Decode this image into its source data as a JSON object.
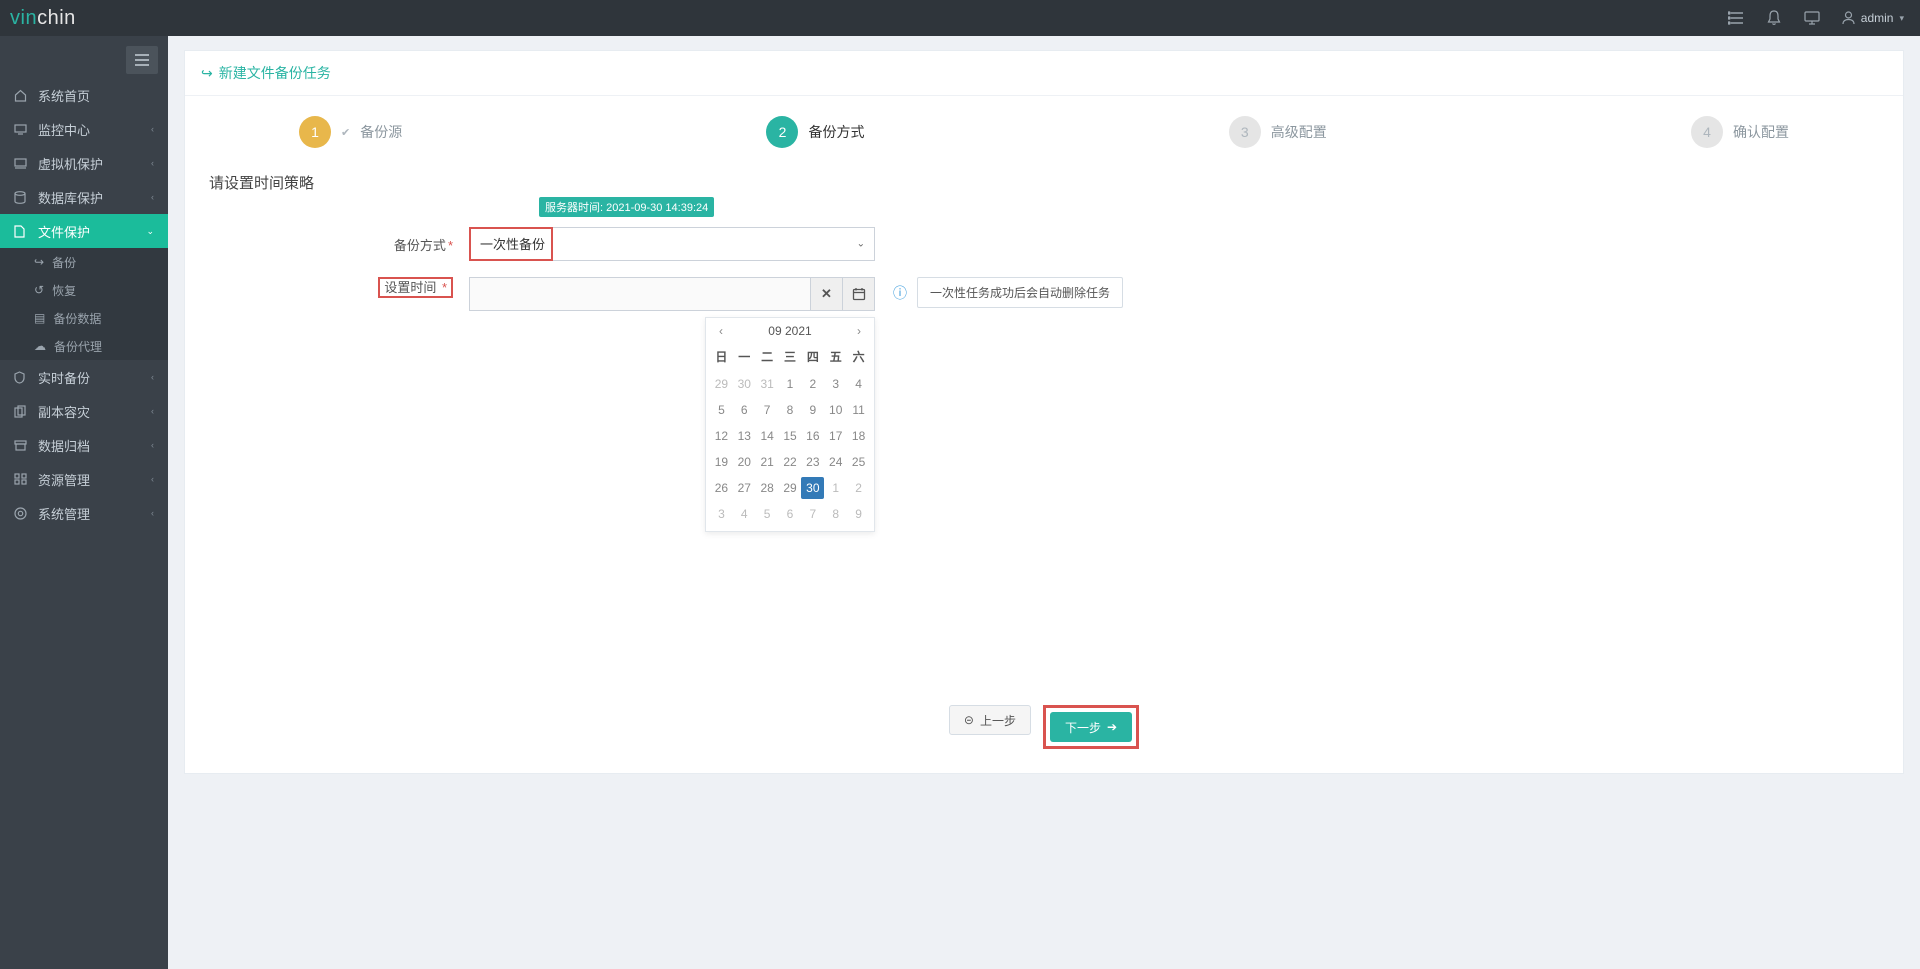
{
  "brand": {
    "pre": "vin",
    "post": "chin"
  },
  "topbar": {
    "user_label": "admin"
  },
  "sidebar": {
    "items": [
      {
        "label": "系统首页",
        "expandable": false
      },
      {
        "label": "监控中心",
        "expandable": true
      },
      {
        "label": "虚拟机保护",
        "expandable": true
      },
      {
        "label": "数据库保护",
        "expandable": true
      },
      {
        "label": "文件保护",
        "expandable": true,
        "active": true
      },
      {
        "label": "实时备份",
        "expandable": true
      },
      {
        "label": "副本容灾",
        "expandable": true
      },
      {
        "label": "数据归档",
        "expandable": true
      },
      {
        "label": "资源管理",
        "expandable": true
      },
      {
        "label": "系统管理",
        "expandable": true
      }
    ],
    "subitems": [
      {
        "label": "备份"
      },
      {
        "label": "恢复"
      },
      {
        "label": "备份数据"
      },
      {
        "label": "备份代理"
      }
    ]
  },
  "page": {
    "title": "新建文件备份任务",
    "steps": [
      {
        "num": "1",
        "label": "备份源",
        "state": "done"
      },
      {
        "num": "2",
        "label": "备份方式",
        "state": "active"
      },
      {
        "num": "3",
        "label": "高级配置",
        "state": "todo"
      },
      {
        "num": "4",
        "label": "确认配置",
        "state": "todo"
      }
    ],
    "section_title": "请设置时间策略",
    "server_time": "服务器时间: 2021-09-30 14:39:24",
    "form": {
      "mode_label": "备份方式",
      "mode_value": "一次性备份",
      "time_label": "设置时间",
      "time_value": "",
      "tip": "一次性任务成功后会自动删除任务"
    },
    "calendar": {
      "month_label": "09 2021",
      "dow": [
        "日",
        "一",
        "二",
        "三",
        "四",
        "五",
        "六"
      ],
      "weeks": [
        [
          {
            "d": "29",
            "o": true
          },
          {
            "d": "30",
            "o": true
          },
          {
            "d": "31",
            "o": true
          },
          {
            "d": "1"
          },
          {
            "d": "2"
          },
          {
            "d": "3"
          },
          {
            "d": "4"
          }
        ],
        [
          {
            "d": "5"
          },
          {
            "d": "6"
          },
          {
            "d": "7"
          },
          {
            "d": "8"
          },
          {
            "d": "9"
          },
          {
            "d": "10"
          },
          {
            "d": "11"
          }
        ],
        [
          {
            "d": "12"
          },
          {
            "d": "13"
          },
          {
            "d": "14"
          },
          {
            "d": "15"
          },
          {
            "d": "16"
          },
          {
            "d": "17"
          },
          {
            "d": "18"
          }
        ],
        [
          {
            "d": "19"
          },
          {
            "d": "20"
          },
          {
            "d": "21"
          },
          {
            "d": "22"
          },
          {
            "d": "23"
          },
          {
            "d": "24"
          },
          {
            "d": "25"
          }
        ],
        [
          {
            "d": "26"
          },
          {
            "d": "27"
          },
          {
            "d": "28"
          },
          {
            "d": "29"
          },
          {
            "d": "30",
            "today": true
          },
          {
            "d": "1",
            "o": true
          },
          {
            "d": "2",
            "o": true
          }
        ],
        [
          {
            "d": "3",
            "o": true
          },
          {
            "d": "4",
            "o": true
          },
          {
            "d": "5",
            "o": true
          },
          {
            "d": "6",
            "o": true
          },
          {
            "d": "7",
            "o": true
          },
          {
            "d": "8",
            "o": true
          },
          {
            "d": "9",
            "o": true
          }
        ]
      ]
    },
    "buttons": {
      "prev": "上一步",
      "next": "下一步"
    }
  }
}
